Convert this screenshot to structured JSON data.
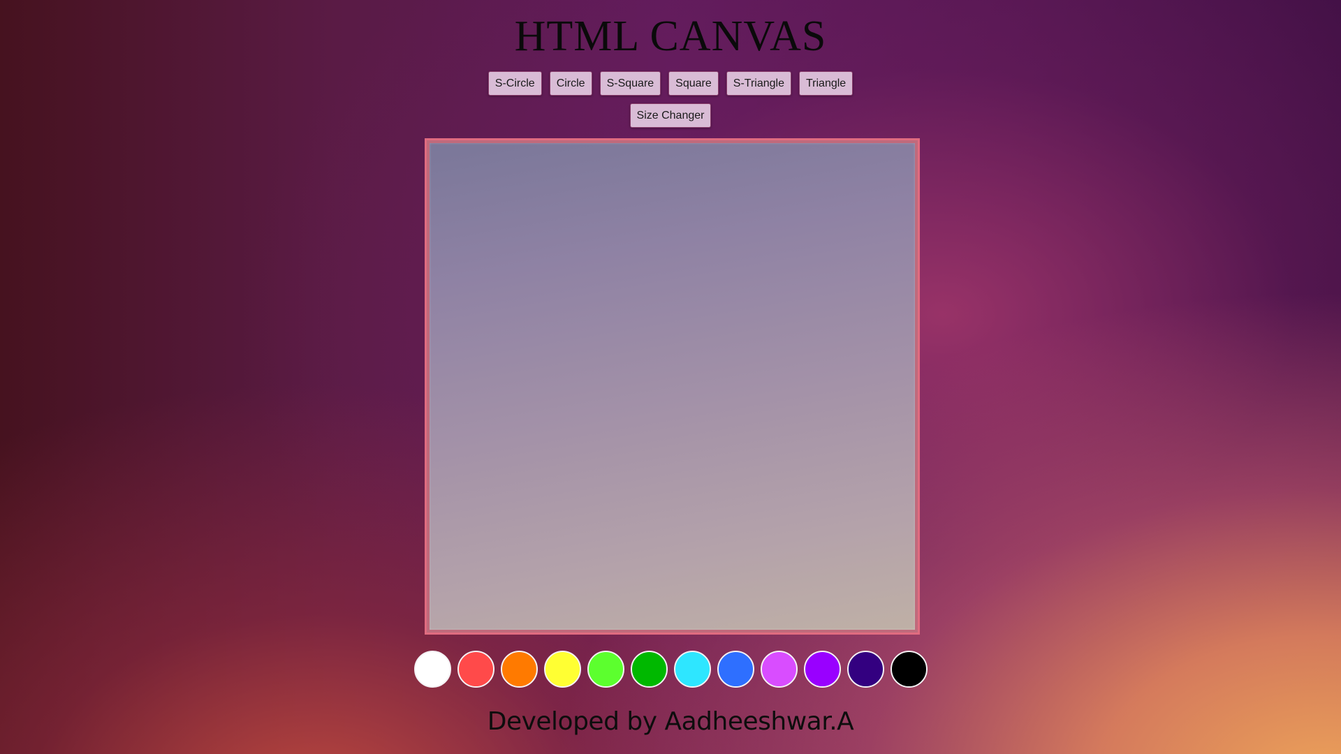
{
  "header": {
    "title": "HTML CANVAS"
  },
  "toolbar": {
    "buttons": [
      {
        "label": "S-Circle"
      },
      {
        "label": "Circle"
      },
      {
        "label": "S-Square"
      },
      {
        "label": "Square"
      },
      {
        "label": "S-Triangle"
      },
      {
        "label": "Triangle"
      }
    ],
    "size_changer_label": "Size Changer"
  },
  "palette": {
    "colors": [
      {
        "name": "white",
        "hex": "#ffffff"
      },
      {
        "name": "red",
        "hex": "#ff4a4a"
      },
      {
        "name": "orange",
        "hex": "#ff7a00"
      },
      {
        "name": "yellow",
        "hex": "#ffff33"
      },
      {
        "name": "light-green",
        "hex": "#5cff2e"
      },
      {
        "name": "green",
        "hex": "#00b800"
      },
      {
        "name": "cyan",
        "hex": "#2ee6ff"
      },
      {
        "name": "blue",
        "hex": "#2e6fff"
      },
      {
        "name": "magenta",
        "hex": "#d94dff"
      },
      {
        "name": "purple",
        "hex": "#9900ff"
      },
      {
        "name": "indigo",
        "hex": "#330080"
      },
      {
        "name": "black",
        "hex": "#000000"
      }
    ]
  },
  "footer": {
    "credit": "Developed by Aadheeshwar.A"
  }
}
